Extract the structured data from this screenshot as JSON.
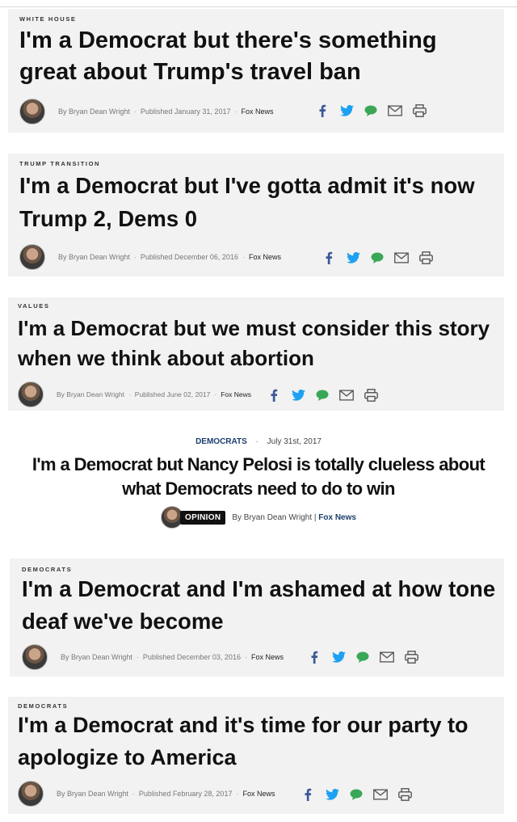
{
  "articles": [
    {
      "kicker": "WHITE HOUSE",
      "headline": "I'm a Democrat but there's something great about Trump's travel ban",
      "byline": "By Bryan Dean Wright",
      "published": "Published January 31, 2017",
      "source": "Fox News"
    },
    {
      "kicker": "TRUMP TRANSITION",
      "headline": "I'm a Democrat but I've gotta admit it's now Trump 2, Dems 0",
      "byline": "By Bryan Dean Wright",
      "published": "Published December 06, 2016",
      "source": "Fox News"
    },
    {
      "kicker": "VALUES",
      "headline": "I'm a Democrat but we must consider this story when we think about abortion",
      "byline": "By Bryan Dean Wright",
      "published": "Published June 02, 2017",
      "source": "Fox News"
    },
    {
      "kicker": "DEMOCRATS",
      "headline": "I'm a Democrat and I'm ashamed at how tone deaf we've become",
      "byline": "By Bryan Dean Wright",
      "published": "Published December 03, 2016",
      "source": "Fox News"
    },
    {
      "kicker": "DEMOCRATS",
      "headline": "I'm a Democrat and it's time for our party to apologize to America",
      "byline": "By Bryan Dean Wright",
      "published": "Published February 28, 2017",
      "source": "Fox News"
    }
  ],
  "opinion_article": {
    "category": "DEMOCRATS",
    "date": "July 31st, 2017",
    "headline": "I'm a Democrat but Nancy Pelosi is totally clueless about what Democrats need to do to win",
    "badge": "OPINION",
    "byline": "By Bryan Dean Wright |",
    "source": "Fox News"
  },
  "share_icons": [
    "facebook-icon",
    "twitter-icon",
    "comment-icon",
    "email-icon",
    "print-icon"
  ],
  "colors": {
    "card_bg": "#f2f2f2",
    "facebook": "#3b5998",
    "twitter": "#1da1f2",
    "comment": "#3aa757",
    "icon_gray": "#555555",
    "category_blue": "#1b3d6b"
  }
}
